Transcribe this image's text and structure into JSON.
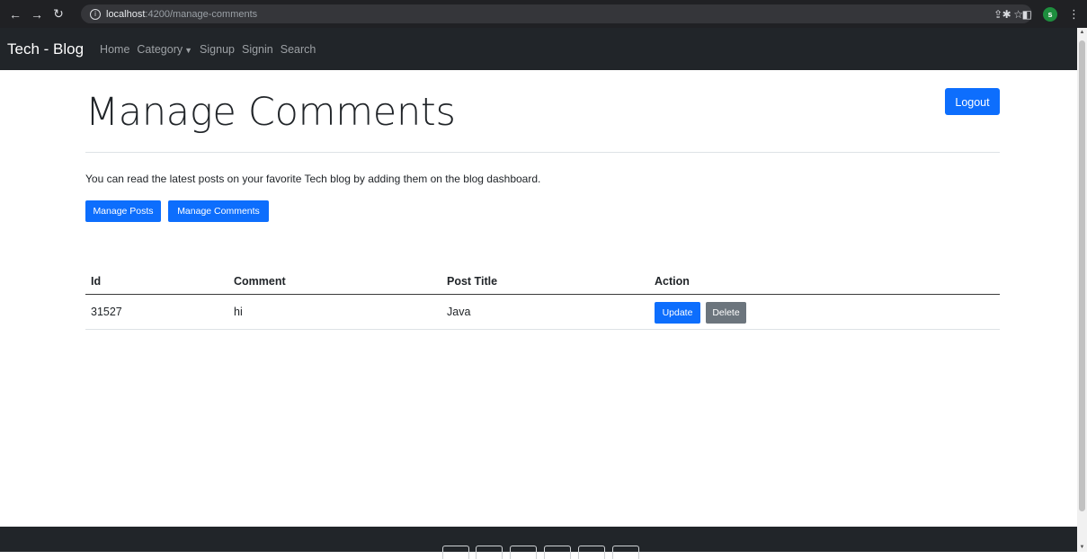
{
  "browser": {
    "url_host": "localhost",
    "url_path": ":4200/manage-comments",
    "avatar_letter": "s"
  },
  "navbar": {
    "brand": "Tech - Blog",
    "links": [
      "Home",
      "Category",
      "Signup",
      "Signin",
      "Search"
    ]
  },
  "page": {
    "logout_label": "Logout",
    "title": "Manage Comments",
    "lead": "You can read the latest posts on your favorite Tech blog by adding them on the blog dashboard.",
    "manage_posts_label": "Manage Posts",
    "manage_comments_label": "Manage Comments"
  },
  "table": {
    "headers": [
      "Id",
      "Comment",
      "Post Title",
      "Action"
    ],
    "rows": [
      {
        "id": "31527",
        "comment": "hi",
        "post_title": "Java",
        "update_label": "Update",
        "delete_label": "Delete"
      }
    ]
  },
  "colors": {
    "primary": "#0d6efd",
    "secondary": "#6c757d",
    "navbar": "#212529"
  },
  "footer": {
    "social_icons": [
      "social-icon-1",
      "social-icon-2",
      "social-icon-3",
      "social-icon-4",
      "social-icon-5",
      "social-icon-6"
    ]
  }
}
